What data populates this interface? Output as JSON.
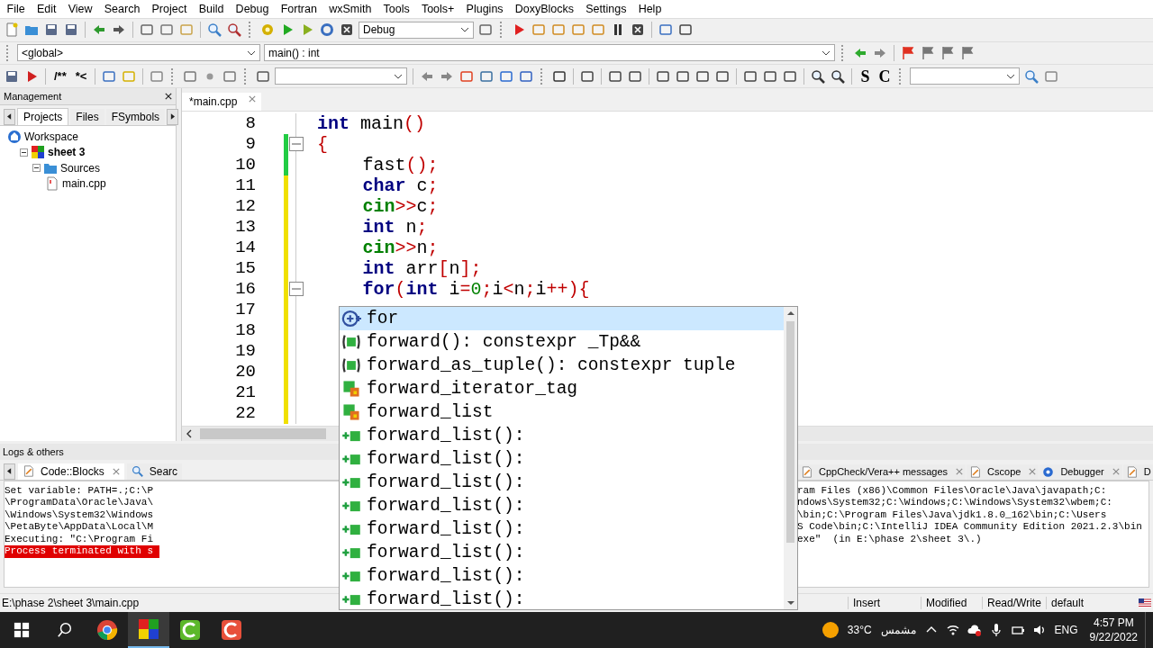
{
  "menu": [
    "File",
    "Edit",
    "View",
    "Search",
    "Project",
    "Build",
    "Debug",
    "Fortran",
    "wxSmith",
    "Tools",
    "Tools+",
    "Plugins",
    "DoxyBlocks",
    "Settings",
    "Help"
  ],
  "toolbars": {
    "build_target": "Debug",
    "scope": "<global>",
    "function": "main() : int",
    "comment_buttons": [
      "/**",
      "*<"
    ],
    "style_buttons": [
      "S",
      "C"
    ]
  },
  "management": {
    "title": "Management",
    "tabs": [
      {
        "label": "Projects",
        "selected": true
      },
      {
        "label": "Files",
        "selected": false
      },
      {
        "label": "FSymbols",
        "selected": false
      }
    ],
    "tree": [
      {
        "label": "Workspace",
        "kind": "workspace",
        "children": [
          {
            "label": "sheet 3",
            "kind": "project",
            "active": true,
            "expanded": true,
            "children": [
              {
                "label": "Sources",
                "kind": "folder",
                "expanded": true,
                "children": [
                  {
                    "label": "main.cpp",
                    "kind": "file"
                  }
                ]
              }
            ]
          }
        ]
      }
    ]
  },
  "editor": {
    "tabs": [
      {
        "label": "*main.cpp",
        "selected": true
      }
    ],
    "lines": [
      {
        "number": "8",
        "fold": false,
        "indented": false,
        "tokens": [
          {
            "kind": "keyword",
            "text": "int"
          },
          {
            "kind": "plain",
            "text": " main"
          },
          {
            "kind": "operator",
            "text": "()"
          }
        ]
      },
      {
        "number": "9",
        "color": "#22cc44",
        "fold": true,
        "indented": false,
        "tokens": [
          {
            "kind": "operator",
            "text": "{"
          }
        ]
      },
      {
        "number": "10",
        "color": "#22cc44",
        "fold": false,
        "indented": true,
        "tokens": [
          {
            "kind": "plain",
            "text": "fast"
          },
          {
            "kind": "operator",
            "text": "();"
          }
        ]
      },
      {
        "number": "11",
        "color": "#f0e000",
        "fold": false,
        "indented": true,
        "tokens": [
          {
            "kind": "keyword",
            "text": "char"
          },
          {
            "kind": "plain",
            "text": " c"
          },
          {
            "kind": "operator",
            "text": ";"
          }
        ]
      },
      {
        "number": "12",
        "color": "#f0e000",
        "fold": false,
        "indented": true,
        "tokens": [
          {
            "kind": "builtin",
            "text": "cin"
          },
          {
            "kind": "operator",
            "text": ">>"
          },
          {
            "kind": "plain",
            "text": "c"
          },
          {
            "kind": "operator",
            "text": ";"
          }
        ]
      },
      {
        "number": "13",
        "color": "#f0e000",
        "fold": false,
        "indented": true,
        "tokens": [
          {
            "kind": "keyword",
            "text": "int"
          },
          {
            "kind": "plain",
            "text": " n"
          },
          {
            "kind": "operator",
            "text": ";"
          }
        ]
      },
      {
        "number": "14",
        "color": "#f0e000",
        "fold": false,
        "indented": true,
        "tokens": [
          {
            "kind": "builtin",
            "text": "cin"
          },
          {
            "kind": "operator",
            "text": ">>"
          },
          {
            "kind": "plain",
            "text": "n"
          },
          {
            "kind": "operator",
            "text": ";"
          }
        ]
      },
      {
        "number": "15",
        "color": "#f0e000",
        "fold": false,
        "indented": true,
        "tokens": [
          {
            "kind": "keyword",
            "text": "int"
          },
          {
            "kind": "plain",
            "text": " arr"
          },
          {
            "kind": "operator",
            "text": "["
          },
          {
            "kind": "plain",
            "text": "n"
          },
          {
            "kind": "operator",
            "text": "];"
          }
        ]
      },
      {
        "number": "16",
        "color": "#f0e000",
        "fold": true,
        "indented": true,
        "tokens": [
          {
            "kind": "keyword",
            "text": "for"
          },
          {
            "kind": "operator",
            "text": "("
          },
          {
            "kind": "keyword",
            "text": "int"
          },
          {
            "kind": "plain",
            "text": " i"
          },
          {
            "kind": "operator",
            "text": "="
          },
          {
            "kind": "number",
            "text": "0"
          },
          {
            "kind": "operator",
            "text": ";"
          },
          {
            "kind": "plain",
            "text": "i"
          },
          {
            "kind": "operator",
            "text": "<"
          },
          {
            "kind": "plain",
            "text": "n"
          },
          {
            "kind": "operator",
            "text": ";"
          },
          {
            "kind": "plain",
            "text": "i"
          },
          {
            "kind": "operator",
            "text": "++){"
          }
        ]
      },
      {
        "number": "17",
        "color": "#f0e000",
        "fold": false
      },
      {
        "number": "18",
        "color": "#f0e000",
        "fold": false
      },
      {
        "number": "19",
        "color": "#f0e000",
        "fold": false
      },
      {
        "number": "20",
        "color": "#f0e000",
        "fold": false
      },
      {
        "number": "21",
        "color": "#f0e000",
        "fold": false
      },
      {
        "number": "22",
        "color": "#f0e000",
        "fold": false
      }
    ]
  },
  "completion": {
    "items": [
      {
        "kind": "keyword",
        "text": "for",
        "selected": true
      },
      {
        "kind": "function",
        "text": "forward(): constexpr _Tp&&",
        "selected": false
      },
      {
        "kind": "function",
        "text": "forward_as_tuple(): constexpr tuple",
        "selected": false
      },
      {
        "kind": "class",
        "text": "forward_iterator_tag",
        "selected": false
      },
      {
        "kind": "class",
        "text": "forward_list",
        "selected": false
      },
      {
        "kind": "constructor",
        "text": "forward_list():",
        "selected": false
      },
      {
        "kind": "constructor",
        "text": "forward_list():",
        "selected": false
      },
      {
        "kind": "constructor",
        "text": "forward_list():",
        "selected": false
      },
      {
        "kind": "constructor",
        "text": "forward_list():",
        "selected": false
      },
      {
        "kind": "constructor",
        "text": "forward_list():",
        "selected": false
      },
      {
        "kind": "constructor",
        "text": "forward_list():",
        "selected": false
      },
      {
        "kind": "constructor",
        "text": "forward_list():",
        "selected": false
      },
      {
        "kind": "constructor",
        "text": "forward_list():",
        "selected": false
      }
    ]
  },
  "logs": {
    "title": "Logs & others",
    "tabs_left": [
      {
        "label": "Code::Blocks",
        "kind": "page",
        "selected": true,
        "closable": true
      },
      {
        "label": "Searc",
        "kind": "search",
        "selected": false,
        "closable": false
      }
    ],
    "tabs_right": [
      {
        "label": "CppCheck/Vera++ messages",
        "kind": "page",
        "selected": false,
        "closable": true
      },
      {
        "label": "Cscope",
        "kind": "page",
        "selected": false,
        "closable": true
      },
      {
        "label": "Debugger",
        "kind": "gear",
        "selected": false,
        "closable": true
      },
      {
        "label": "D",
        "kind": "page",
        "selected": false,
        "closable": false
      }
    ],
    "left_lines": [
      {
        "text": "Set variable: PATH=.;C:\\P",
        "error": false
      },
      {
        "text": "\\ProgramData\\Oracle\\Java\\",
        "error": false
      },
      {
        "text": "\\Windows\\System32\\Windows",
        "error": false
      },
      {
        "text": "\\PetaByte\\AppData\\Local\\M",
        "error": false
      },
      {
        "text": "Executing: \"C:\\Program Fi",
        "error": false
      },
      {
        "text": "Process terminated with s",
        "error": true
      }
    ],
    "right_lines": [
      {
        "text": "ram Files (x86)\\Common Files\\Oracle\\Java\\javapath;C:"
      },
      {
        "text": "ndows\\System32;C:\\Windows;C:\\Windows\\System32\\wbem;C:"
      },
      {
        "text": "\\bin;C:\\Program Files\\Java\\jdk1.8.0_162\\bin;C:\\Users"
      },
      {
        "text": "S Code\\bin;C:\\IntelliJ IDEA Community Edition 2021.2.3\\bin"
      },
      {
        "text": "exe\"  (in E:\\phase 2\\sheet 3\\.)"
      }
    ]
  },
  "status_bar": {
    "path": "E:\\phase 2\\sheet 3\\main.cpp",
    "mode": "Insert",
    "modified": "Modified",
    "access": "Read/Write",
    "encoding": "default"
  },
  "taskbar": {
    "apps": [
      {
        "kind": "browser",
        "selected": false
      },
      {
        "kind": "codeblocks",
        "selected": true
      },
      {
        "kind": "green-c",
        "selected": false
      },
      {
        "kind": "red-c",
        "selected": false
      }
    ],
    "temperature": "33°C",
    "weather": "مشمس",
    "language": "ENG",
    "time": "4:57 PM",
    "date": "9/22/2022"
  }
}
